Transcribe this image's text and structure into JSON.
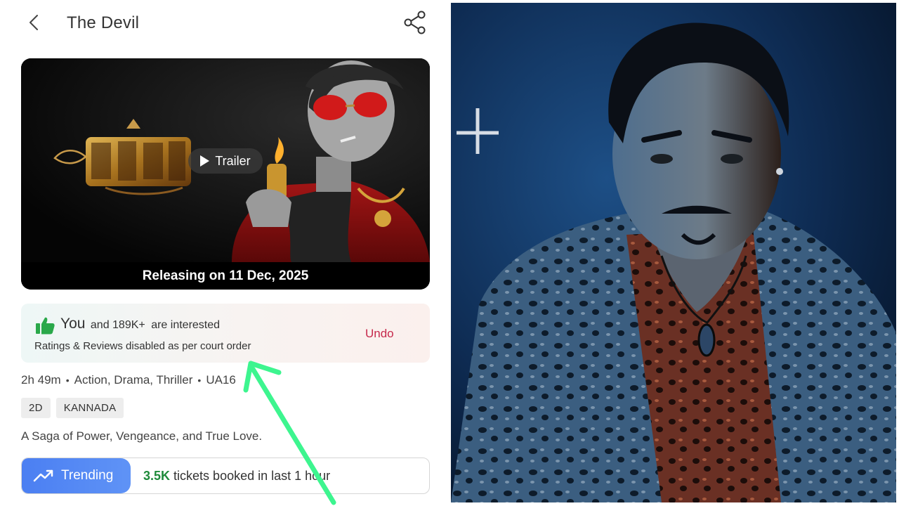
{
  "header": {
    "title": "The Devil",
    "back_icon": "chevron-left-icon",
    "share_icon": "share-icon"
  },
  "hero": {
    "trailer_label": "Trailer",
    "release_text": "Releasing on 11 Dec, 2025"
  },
  "interest": {
    "you": "You",
    "and_count": "and 189K+",
    "interested": "are interested",
    "note": "Ratings & Reviews disabled as per court order",
    "undo_label": "Undo",
    "thumb_color": "#2aa84a"
  },
  "meta": {
    "duration": "2h 49m",
    "genres": "Action, Drama, Thriller",
    "certificate": "UA16"
  },
  "chips": [
    "2D",
    "KANNADA"
  ],
  "tagline": "A Saga of Power, Vengeance, and True Love.",
  "trending": {
    "label": "Trending",
    "count": "3.5K",
    "text": "tickets booked in last 1 hour"
  },
  "colors": {
    "accent_undo": "#c6294c",
    "trend_blue": "#4b7ff2",
    "count_green": "#1e8a3a",
    "annotation_arrow": "#3df58f"
  }
}
